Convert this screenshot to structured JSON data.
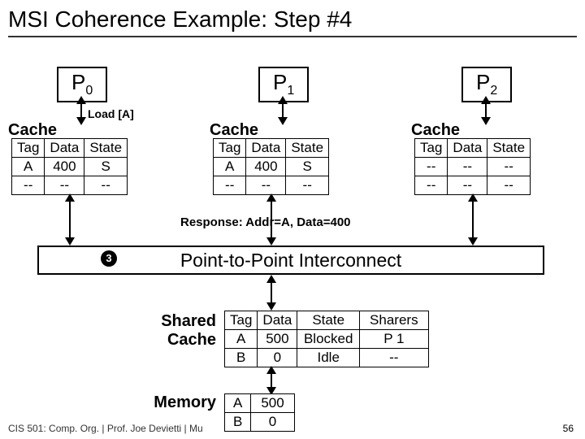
{
  "title": "MSI Coherence Example: Step #4",
  "step_badge": "3",
  "load_label": "Load [A]",
  "cache_label": "Cache",
  "procs": [
    "P",
    "P",
    "P"
  ],
  "proc_sub": [
    "0",
    "1",
    "2"
  ],
  "cache_headers": [
    "Tag",
    "Data",
    "State"
  ],
  "cache0": [
    [
      "A",
      "400",
      "S"
    ],
    [
      "--",
      "--",
      "--"
    ]
  ],
  "cache1": [
    [
      "A",
      "400",
      "S"
    ],
    [
      "--",
      "--",
      "--"
    ]
  ],
  "cache2": [
    [
      "--",
      "--",
      "--"
    ],
    [
      "--",
      "--",
      "--"
    ]
  ],
  "response_text": "Response: Addr=A, Data=400",
  "interconnect_label": "Point-to-Point Interconnect",
  "shared_label_a": "Shared",
  "shared_label_b": "Cache",
  "shared_headers": [
    "Tag",
    "Data",
    "State",
    "Sharers"
  ],
  "shared_rows": [
    [
      "A",
      "500",
      "Blocked",
      "P 1"
    ],
    [
      "B",
      "0",
      "Idle",
      "--"
    ]
  ],
  "memory_label": "Memory",
  "memory_rows": [
    [
      "A",
      "500"
    ],
    [
      "B",
      "0"
    ]
  ],
  "footer": "CIS 501: Comp. Org. |  Prof. Joe Devietti  |  Mu",
  "pagenum": "56"
}
